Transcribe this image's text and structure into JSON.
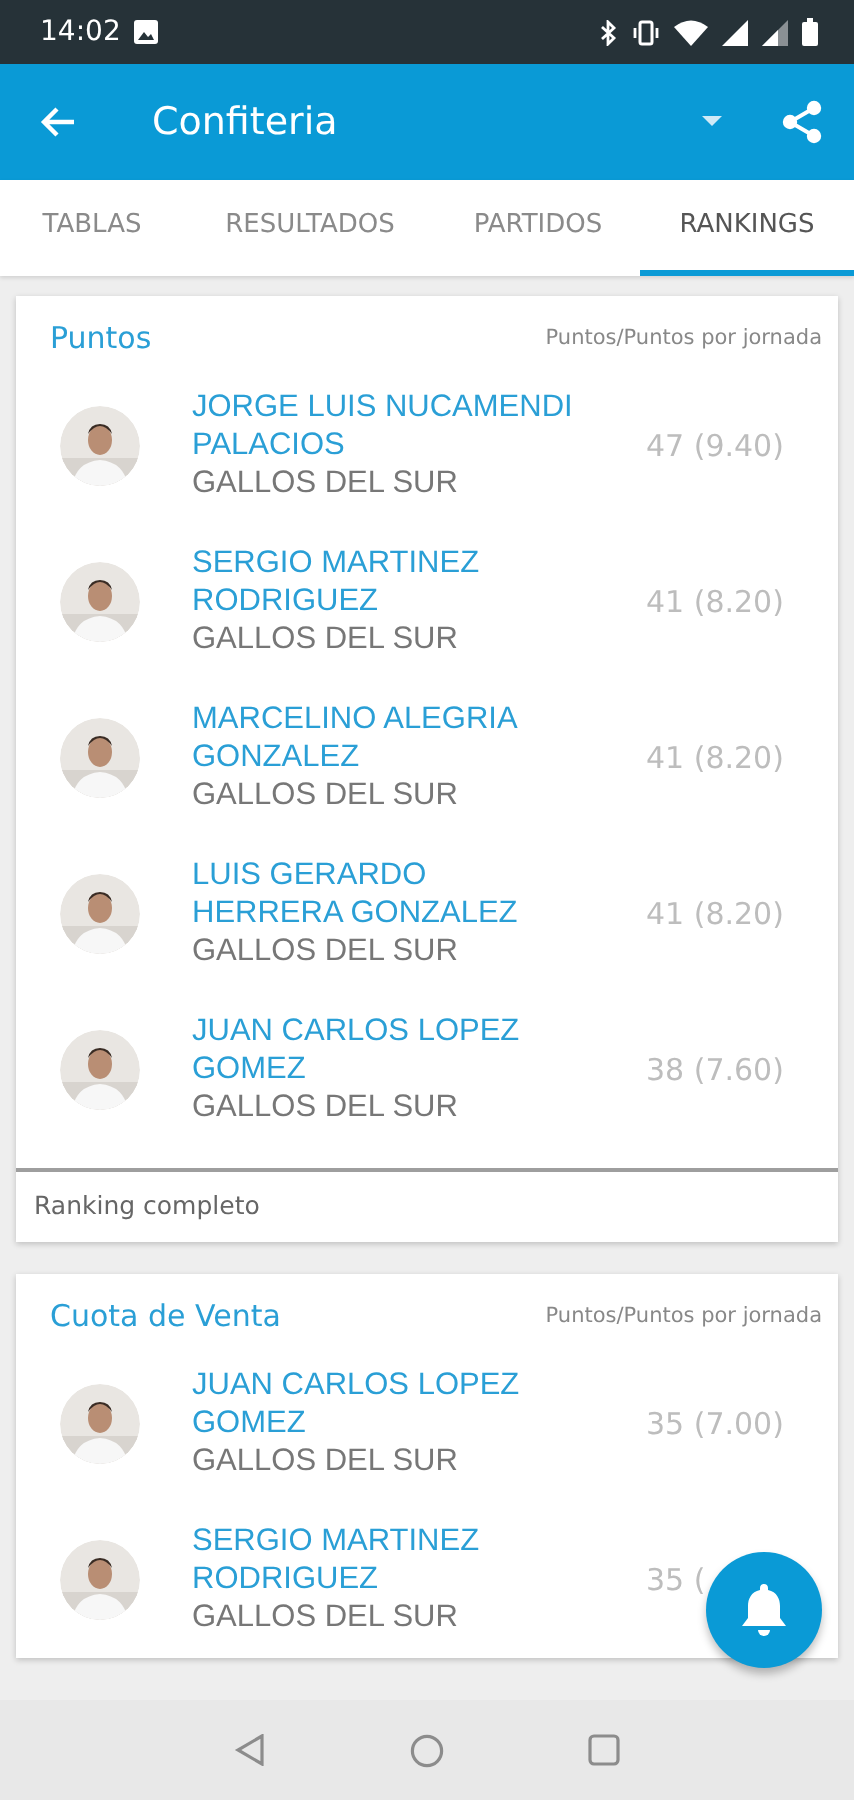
{
  "status_bar": {
    "time": "14:02"
  },
  "app_bar": {
    "title": "Confiteria"
  },
  "tabs": [
    {
      "label": "TABLAS",
      "selected": false
    },
    {
      "label": "RESULTADOS",
      "selected": false
    },
    {
      "label": "PARTIDOS",
      "selected": false
    },
    {
      "label": "RANKINGS",
      "selected": true
    }
  ],
  "cards": [
    {
      "title": "Puntos",
      "legend": "Puntos/Puntos por jornada",
      "rows": [
        {
          "name": "JORGE LUIS NUCAMENDI PALACIOS",
          "team": "GALLOS DEL SUR",
          "score": "47 (9.40)"
        },
        {
          "name": "SERGIO MARTINEZ RODRIGUEZ",
          "team": "GALLOS DEL SUR",
          "score": "41 (8.20)"
        },
        {
          "name": "MARCELINO ALEGRIA GONZALEZ",
          "team": "GALLOS DEL SUR",
          "score": "41 (8.20)"
        },
        {
          "name": "LUIS GERARDO HERRERA GONZALEZ",
          "team": "GALLOS DEL SUR",
          "score": "41 (8.20)"
        },
        {
          "name": "JUAN CARLOS LOPEZ GOMEZ",
          "team": "GALLOS DEL SUR",
          "score": "38 (7.60)"
        }
      ],
      "footer": "Ranking completo"
    },
    {
      "title": "Cuota de Venta",
      "legend": "Puntos/Puntos por jornada",
      "rows": [
        {
          "name": "JUAN CARLOS LOPEZ GOMEZ",
          "team": "GALLOS DEL SUR",
          "score": "35 (7.00)"
        },
        {
          "name": "SERGIO MARTINEZ RODRIGUEZ",
          "team": "GALLOS DEL SUR",
          "score": "35 ("
        }
      ]
    }
  ]
}
